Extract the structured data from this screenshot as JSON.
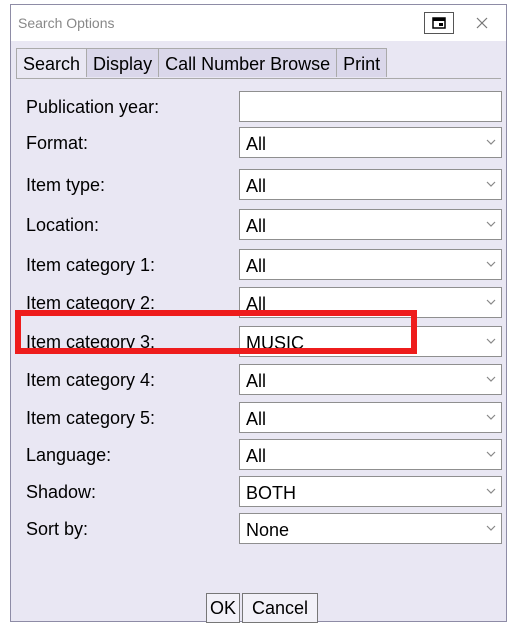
{
  "window": {
    "title": "Search Options"
  },
  "tabs": [
    {
      "label": "Search",
      "active": true
    },
    {
      "label": "Display",
      "active": false
    },
    {
      "label": "Call Number Browse",
      "active": false
    },
    {
      "label": "Print",
      "active": false
    }
  ],
  "fields": [
    {
      "label": "Publication year:",
      "value": "",
      "type": "text"
    },
    {
      "label": "Format:",
      "value": "All",
      "type": "select"
    },
    {
      "label": "Item type:",
      "value": "All",
      "type": "select"
    },
    {
      "label": "Location:",
      "value": "All",
      "type": "select"
    },
    {
      "label": "Item category 1:",
      "value": "All",
      "type": "select"
    },
    {
      "label": "Item category 2:",
      "value": "All",
      "type": "select"
    },
    {
      "label": "Item category 3:",
      "value": "MUSIC",
      "type": "select"
    },
    {
      "label": "Item category 4:",
      "value": "All",
      "type": "select"
    },
    {
      "label": "Item category 5:",
      "value": "All",
      "type": "select"
    },
    {
      "label": "Language:",
      "value": "All",
      "type": "select"
    },
    {
      "label": "Shadow:",
      "value": "BOTH",
      "type": "select"
    },
    {
      "label": "Sort by:",
      "value": "None",
      "type": "select"
    }
  ],
  "buttons": {
    "ok": "OK",
    "cancel": "Cancel"
  },
  "colors": {
    "highlight": "#ee1c1c",
    "window_bg": "#e9e7f3"
  }
}
